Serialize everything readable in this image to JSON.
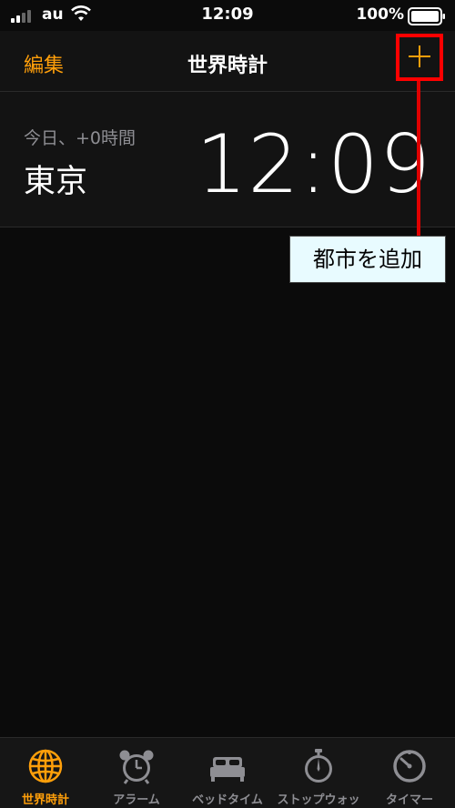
{
  "status_bar": {
    "carrier": "au",
    "time": "12:09",
    "battery_percent": "100%"
  },
  "nav": {
    "edit_label": "編集",
    "title": "世界時計",
    "add_icon": "plus-icon"
  },
  "clocks": [
    {
      "offset": "今日、+0時間",
      "city": "東京",
      "time": "12:09"
    }
  ],
  "annotation": {
    "callout": "都市を追加"
  },
  "tabs": [
    {
      "label": "世界時計",
      "icon": "globe-icon",
      "active": true
    },
    {
      "label": "アラーム",
      "icon": "alarm-clock-icon",
      "active": false
    },
    {
      "label": "ベッドタイム",
      "icon": "bed-icon",
      "active": false
    },
    {
      "label": "ストップウォッチ",
      "icon": "stopwatch-icon",
      "active": false
    },
    {
      "label": "タイマー",
      "icon": "timer-icon",
      "active": false
    }
  ],
  "colors": {
    "accent": "#ff9f0a",
    "annotation_red": "#ff0000",
    "callout_bg": "#e8fbff"
  }
}
